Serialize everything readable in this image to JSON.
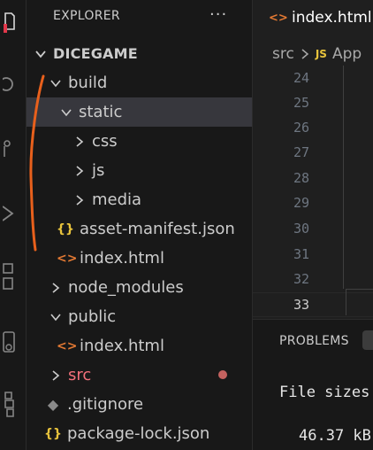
{
  "explorer": {
    "title": "EXPLORER",
    "more_actions": "···",
    "project": "DICEGAME",
    "items": [
      {
        "label": "build"
      },
      {
        "label": "static"
      },
      {
        "label": "css"
      },
      {
        "label": "js"
      },
      {
        "label": "media"
      },
      {
        "label": "asset-manifest.json",
        "icon_text": "{}"
      },
      {
        "label": "index.html",
        "icon_text": "<>"
      },
      {
        "label": "node_modules"
      },
      {
        "label": "public"
      },
      {
        "label": "index.html",
        "icon_text": "<>"
      },
      {
        "label": "src",
        "status": "modified"
      },
      {
        "label": ".gitignore",
        "icon_text": "◆"
      },
      {
        "label": "package-lock.json",
        "icon_text": "{}"
      }
    ]
  },
  "editor": {
    "tab_icon_text": "<>",
    "tab_label": "index.html",
    "breadcrumb": {
      "folder": "src",
      "file_icon_text": "JS",
      "file": "App"
    },
    "line_numbers": [
      "24",
      "25",
      "26",
      "27",
      "28",
      "29",
      "30",
      "31",
      "32",
      "33"
    ],
    "current_line": "33"
  },
  "panel": {
    "tab": "PROBLEMS",
    "lines": [
      "File sizes",
      "46.37 kB"
    ]
  },
  "colors": {
    "accent_annotation": "#e8601c",
    "modified_dot": "#c4625f",
    "json_icon": "#e8c33c",
    "html_icon": "#e37933"
  }
}
